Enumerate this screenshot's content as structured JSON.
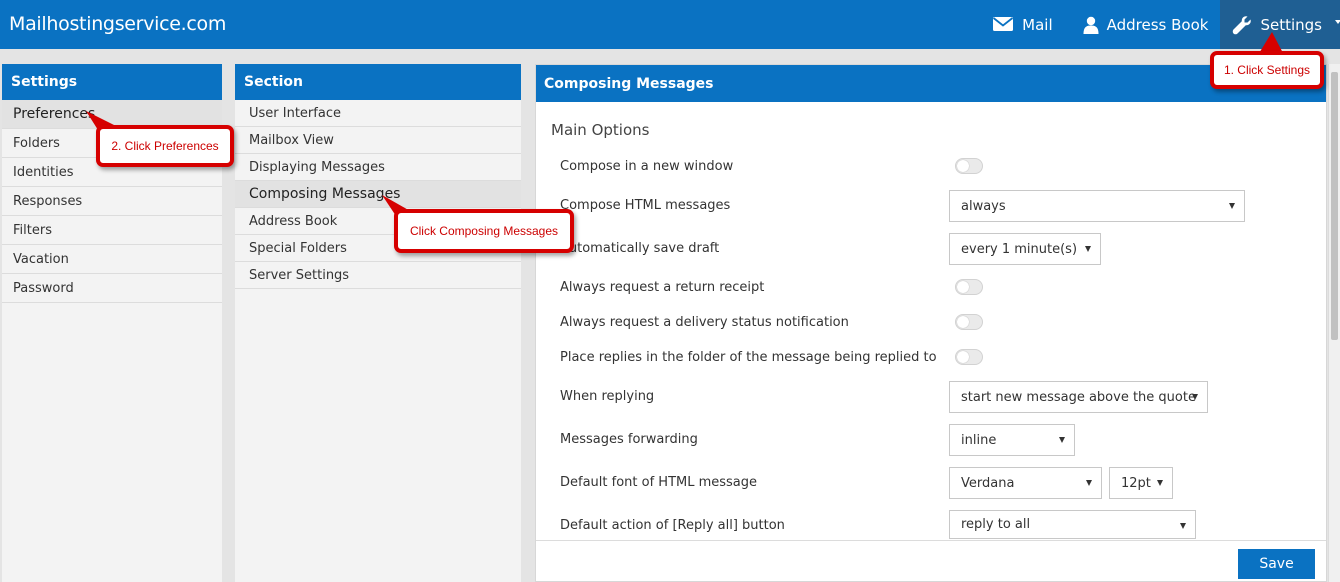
{
  "topbar": {
    "brand": "Mailhostingservice.com",
    "nav": [
      {
        "label": "Mail",
        "icon": "envelope-icon"
      },
      {
        "label": "Address Book",
        "icon": "user-icon"
      },
      {
        "label": "Settings",
        "icon": "wrench-icon"
      }
    ]
  },
  "settings_panel": {
    "title": "Settings",
    "items": [
      "Preferences",
      "Folders",
      "Identities",
      "Responses",
      "Filters",
      "Vacation",
      "Password"
    ],
    "selected": "Preferences"
  },
  "section_panel": {
    "title": "Section",
    "items": [
      "User Interface",
      "Mailbox View",
      "Displaying Messages",
      "Composing Messages",
      "Address Book",
      "Special Folders",
      "Server Settings"
    ],
    "selected": "Composing Messages"
  },
  "main": {
    "title": "Composing Messages",
    "section_title": "Main Options",
    "rows": {
      "compose_new_window": "Compose in a new window",
      "compose_html": "Compose HTML messages",
      "autosave": "Automatically save draft",
      "return_receipt": "Always request a return receipt",
      "delivery_status": "Always request a delivery status notification",
      "place_replies": "Place replies in the folder of the message being replied to",
      "when_replying": "When replying",
      "forwarding": "Messages forwarding",
      "default_font": "Default font of HTML message",
      "reply_all": "Default action of [Reply all] button"
    },
    "values": {
      "compose_html": "always",
      "autosave": "every 1 minute(s)",
      "when_replying": "start new message above the quote",
      "forwarding": "inline",
      "font_family": "Verdana",
      "font_size": "12pt",
      "reply_all": "reply to all"
    },
    "save_label": "Save"
  },
  "callouts": {
    "settings": "1. Click Settings",
    "preferences": "2. Click Preferences",
    "composing": "Click Composing Messages"
  },
  "colors": {
    "brand_blue": "#0a72c2",
    "callout_red": "#d60000"
  }
}
